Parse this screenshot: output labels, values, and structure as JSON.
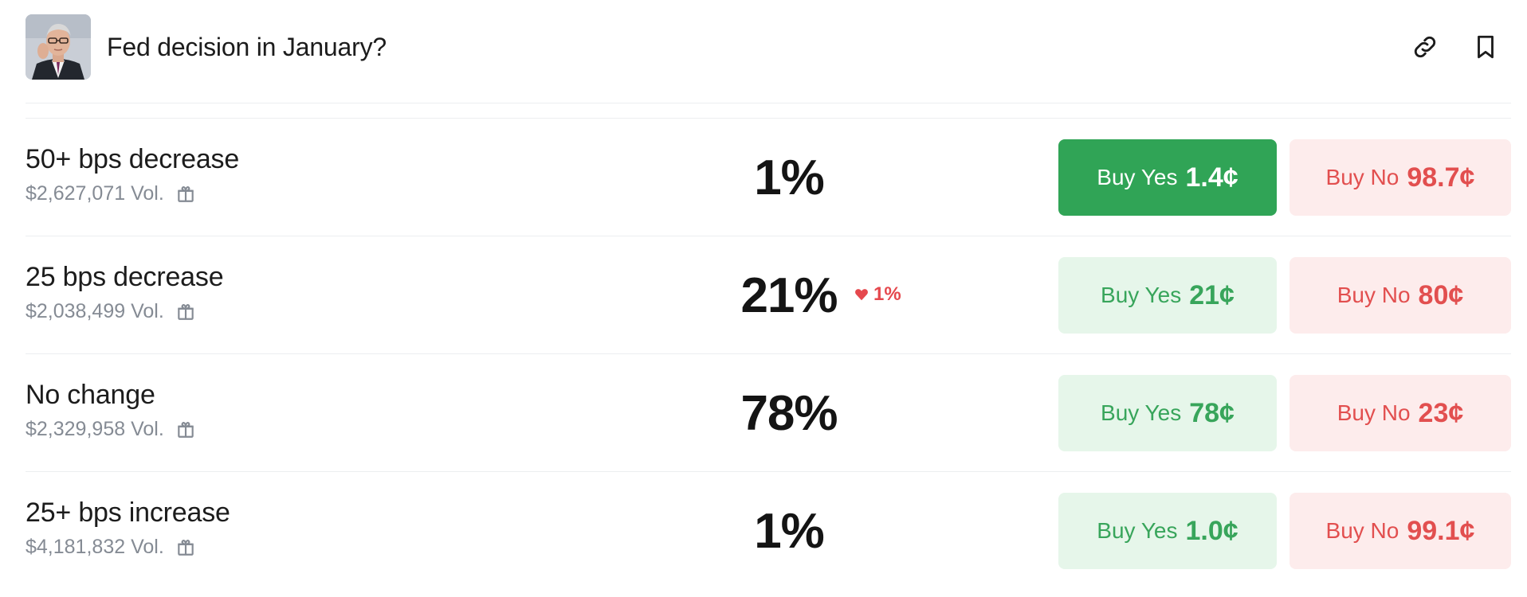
{
  "market": {
    "title": "Fed decision in January?",
    "avatar_icon": "powell-portrait"
  },
  "header_actions": [
    {
      "name": "link-icon"
    },
    {
      "name": "bookmark-icon"
    }
  ],
  "outcomes": [
    {
      "name": "50+ bps decrease",
      "volume": "$2,627,071 Vol.",
      "probability": "1%",
      "change": "",
      "yes_label": "Buy Yes",
      "yes_price": "1.4¢",
      "no_label": "Buy No",
      "no_price": "98.7¢",
      "yes_selected": true
    },
    {
      "name": "25 bps decrease",
      "volume": "$2,038,499 Vol.",
      "probability": "21%",
      "change": "1%",
      "change_direction": "down",
      "yes_label": "Buy Yes",
      "yes_price": "21¢",
      "no_label": "Buy No",
      "no_price": "80¢",
      "yes_selected": false
    },
    {
      "name": "No change",
      "volume": "$2,329,958 Vol.",
      "probability": "78%",
      "change": "",
      "yes_label": "Buy Yes",
      "yes_price": "78¢",
      "no_label": "Buy No",
      "no_price": "23¢",
      "yes_selected": false
    },
    {
      "name": "25+ bps increase",
      "volume": "$4,181,832 Vol.",
      "probability": "1%",
      "change": "",
      "yes_label": "Buy Yes",
      "yes_price": "1.0¢",
      "no_label": "Buy No",
      "no_price": "99.1¢",
      "yes_selected": false
    }
  ],
  "colors": {
    "yes_active_bg": "#30a456",
    "yes_bg": "#e6f6ea",
    "yes_text": "#38a55b",
    "no_bg": "#fdecec",
    "no_text": "#e24f4f",
    "change_down": "#e5484d"
  }
}
